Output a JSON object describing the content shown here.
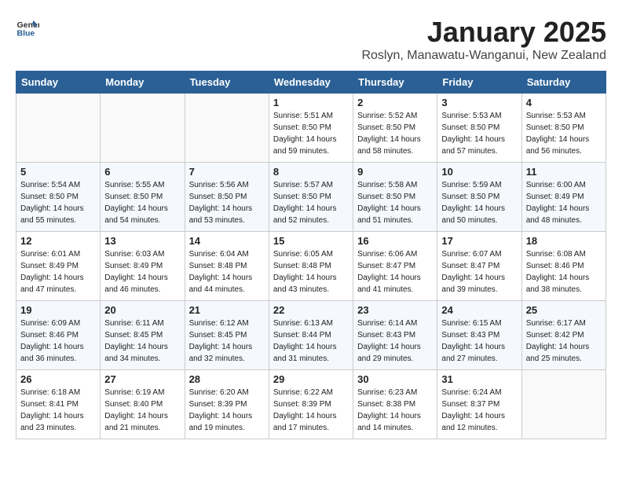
{
  "header": {
    "logo_general": "General",
    "logo_blue": "Blue",
    "title": "January 2025",
    "subtitle": "Roslyn, Manawatu-Wanganui, New Zealand"
  },
  "weekdays": [
    "Sunday",
    "Monday",
    "Tuesday",
    "Wednesday",
    "Thursday",
    "Friday",
    "Saturday"
  ],
  "weeks": [
    [
      {
        "day": "",
        "info": ""
      },
      {
        "day": "",
        "info": ""
      },
      {
        "day": "",
        "info": ""
      },
      {
        "day": "1",
        "info": "Sunrise: 5:51 AM\nSunset: 8:50 PM\nDaylight: 14 hours\nand 59 minutes."
      },
      {
        "day": "2",
        "info": "Sunrise: 5:52 AM\nSunset: 8:50 PM\nDaylight: 14 hours\nand 58 minutes."
      },
      {
        "day": "3",
        "info": "Sunrise: 5:53 AM\nSunset: 8:50 PM\nDaylight: 14 hours\nand 57 minutes."
      },
      {
        "day": "4",
        "info": "Sunrise: 5:53 AM\nSunset: 8:50 PM\nDaylight: 14 hours\nand 56 minutes."
      }
    ],
    [
      {
        "day": "5",
        "info": "Sunrise: 5:54 AM\nSunset: 8:50 PM\nDaylight: 14 hours\nand 55 minutes."
      },
      {
        "day": "6",
        "info": "Sunrise: 5:55 AM\nSunset: 8:50 PM\nDaylight: 14 hours\nand 54 minutes."
      },
      {
        "day": "7",
        "info": "Sunrise: 5:56 AM\nSunset: 8:50 PM\nDaylight: 14 hours\nand 53 minutes."
      },
      {
        "day": "8",
        "info": "Sunrise: 5:57 AM\nSunset: 8:50 PM\nDaylight: 14 hours\nand 52 minutes."
      },
      {
        "day": "9",
        "info": "Sunrise: 5:58 AM\nSunset: 8:50 PM\nDaylight: 14 hours\nand 51 minutes."
      },
      {
        "day": "10",
        "info": "Sunrise: 5:59 AM\nSunset: 8:50 PM\nDaylight: 14 hours\nand 50 minutes."
      },
      {
        "day": "11",
        "info": "Sunrise: 6:00 AM\nSunset: 8:49 PM\nDaylight: 14 hours\nand 48 minutes."
      }
    ],
    [
      {
        "day": "12",
        "info": "Sunrise: 6:01 AM\nSunset: 8:49 PM\nDaylight: 14 hours\nand 47 minutes."
      },
      {
        "day": "13",
        "info": "Sunrise: 6:03 AM\nSunset: 8:49 PM\nDaylight: 14 hours\nand 46 minutes."
      },
      {
        "day": "14",
        "info": "Sunrise: 6:04 AM\nSunset: 8:48 PM\nDaylight: 14 hours\nand 44 minutes."
      },
      {
        "day": "15",
        "info": "Sunrise: 6:05 AM\nSunset: 8:48 PM\nDaylight: 14 hours\nand 43 minutes."
      },
      {
        "day": "16",
        "info": "Sunrise: 6:06 AM\nSunset: 8:47 PM\nDaylight: 14 hours\nand 41 minutes."
      },
      {
        "day": "17",
        "info": "Sunrise: 6:07 AM\nSunset: 8:47 PM\nDaylight: 14 hours\nand 39 minutes."
      },
      {
        "day": "18",
        "info": "Sunrise: 6:08 AM\nSunset: 8:46 PM\nDaylight: 14 hours\nand 38 minutes."
      }
    ],
    [
      {
        "day": "19",
        "info": "Sunrise: 6:09 AM\nSunset: 8:46 PM\nDaylight: 14 hours\nand 36 minutes."
      },
      {
        "day": "20",
        "info": "Sunrise: 6:11 AM\nSunset: 8:45 PM\nDaylight: 14 hours\nand 34 minutes."
      },
      {
        "day": "21",
        "info": "Sunrise: 6:12 AM\nSunset: 8:45 PM\nDaylight: 14 hours\nand 32 minutes."
      },
      {
        "day": "22",
        "info": "Sunrise: 6:13 AM\nSunset: 8:44 PM\nDaylight: 14 hours\nand 31 minutes."
      },
      {
        "day": "23",
        "info": "Sunrise: 6:14 AM\nSunset: 8:43 PM\nDaylight: 14 hours\nand 29 minutes."
      },
      {
        "day": "24",
        "info": "Sunrise: 6:15 AM\nSunset: 8:43 PM\nDaylight: 14 hours\nand 27 minutes."
      },
      {
        "day": "25",
        "info": "Sunrise: 6:17 AM\nSunset: 8:42 PM\nDaylight: 14 hours\nand 25 minutes."
      }
    ],
    [
      {
        "day": "26",
        "info": "Sunrise: 6:18 AM\nSunset: 8:41 PM\nDaylight: 14 hours\nand 23 minutes."
      },
      {
        "day": "27",
        "info": "Sunrise: 6:19 AM\nSunset: 8:40 PM\nDaylight: 14 hours\nand 21 minutes."
      },
      {
        "day": "28",
        "info": "Sunrise: 6:20 AM\nSunset: 8:39 PM\nDaylight: 14 hours\nand 19 minutes."
      },
      {
        "day": "29",
        "info": "Sunrise: 6:22 AM\nSunset: 8:39 PM\nDaylight: 14 hours\nand 17 minutes."
      },
      {
        "day": "30",
        "info": "Sunrise: 6:23 AM\nSunset: 8:38 PM\nDaylight: 14 hours\nand 14 minutes."
      },
      {
        "day": "31",
        "info": "Sunrise: 6:24 AM\nSunset: 8:37 PM\nDaylight: 14 hours\nand 12 minutes."
      },
      {
        "day": "",
        "info": ""
      }
    ]
  ]
}
